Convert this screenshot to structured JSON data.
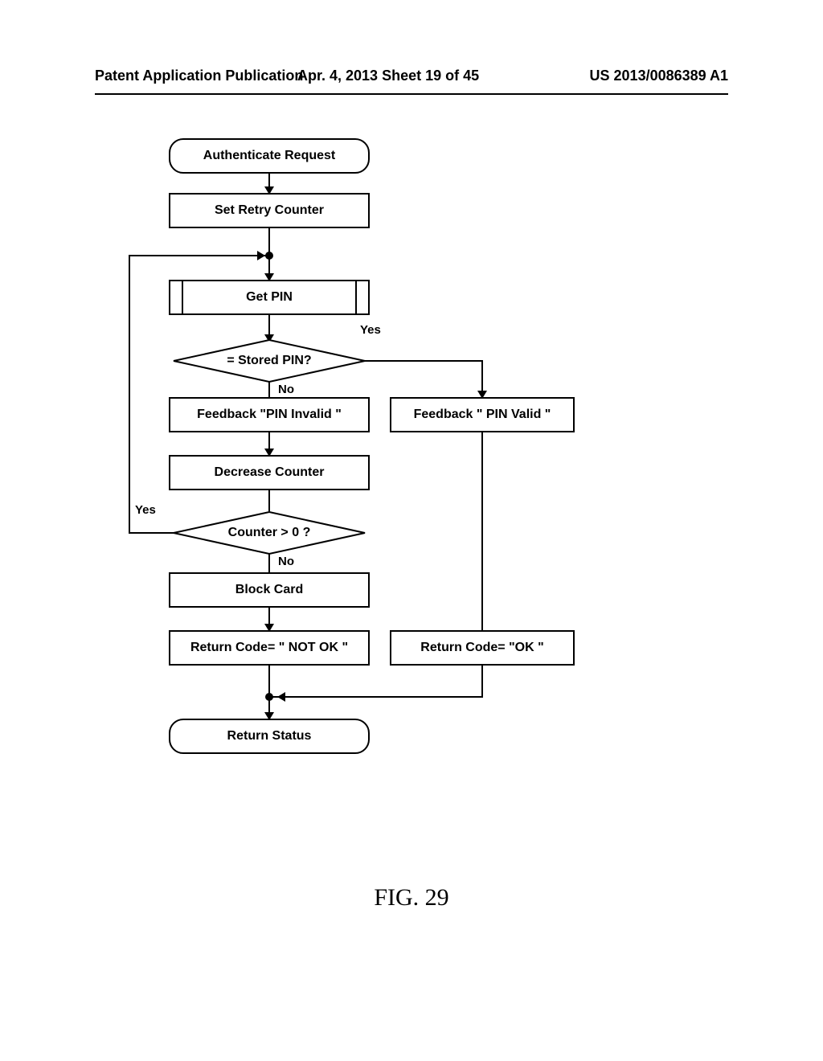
{
  "header": {
    "left": "Patent Application Publication",
    "center": "Apr. 4, 2013  Sheet 19 of 45",
    "right": "US 2013/0086389 A1"
  },
  "figure_label": "FIG. 29",
  "chart_data": {
    "type": "flowchart",
    "nodes": [
      {
        "id": "n1",
        "type": "terminator",
        "label": "Authenticate Request"
      },
      {
        "id": "n2",
        "type": "process",
        "label": "Set Retry Counter"
      },
      {
        "id": "n3",
        "type": "subprocess",
        "label": "Get PIN"
      },
      {
        "id": "n4",
        "type": "decision",
        "label": "= Stored PIN?"
      },
      {
        "id": "n5",
        "type": "process",
        "label": "Feedback \"PIN Invalid \""
      },
      {
        "id": "n6",
        "type": "process",
        "label": "Feedback \" PIN Valid \""
      },
      {
        "id": "n7",
        "type": "process",
        "label": "Decrease Counter"
      },
      {
        "id": "n8",
        "type": "decision",
        "label": "Counter > 0 ?"
      },
      {
        "id": "n9",
        "type": "process",
        "label": "Block Card"
      },
      {
        "id": "n10",
        "type": "process",
        "label": "Return Code= \" NOT OK \""
      },
      {
        "id": "n11",
        "type": "process",
        "label": "Return Code= \"OK \""
      },
      {
        "id": "n12",
        "type": "terminator",
        "label": "Return Status"
      }
    ],
    "edges": [
      {
        "from": "n1",
        "to": "n2"
      },
      {
        "from": "n2",
        "to": "n3"
      },
      {
        "from": "n3",
        "to": "n4"
      },
      {
        "from": "n4",
        "to": "n5",
        "label": "No"
      },
      {
        "from": "n4",
        "to": "n6",
        "label": "Yes"
      },
      {
        "from": "n5",
        "to": "n7"
      },
      {
        "from": "n7",
        "to": "n8"
      },
      {
        "from": "n8",
        "to": "n3",
        "label": "Yes"
      },
      {
        "from": "n8",
        "to": "n9",
        "label": "No"
      },
      {
        "from": "n9",
        "to": "n10"
      },
      {
        "from": "n6",
        "to": "n11"
      },
      {
        "from": "n10",
        "to": "n12"
      },
      {
        "from": "n11",
        "to": "n12"
      }
    ],
    "branch_labels": {
      "d1_yes": "Yes",
      "d1_no": "No",
      "d2_yes": "Yes",
      "d2_no": "No"
    }
  }
}
